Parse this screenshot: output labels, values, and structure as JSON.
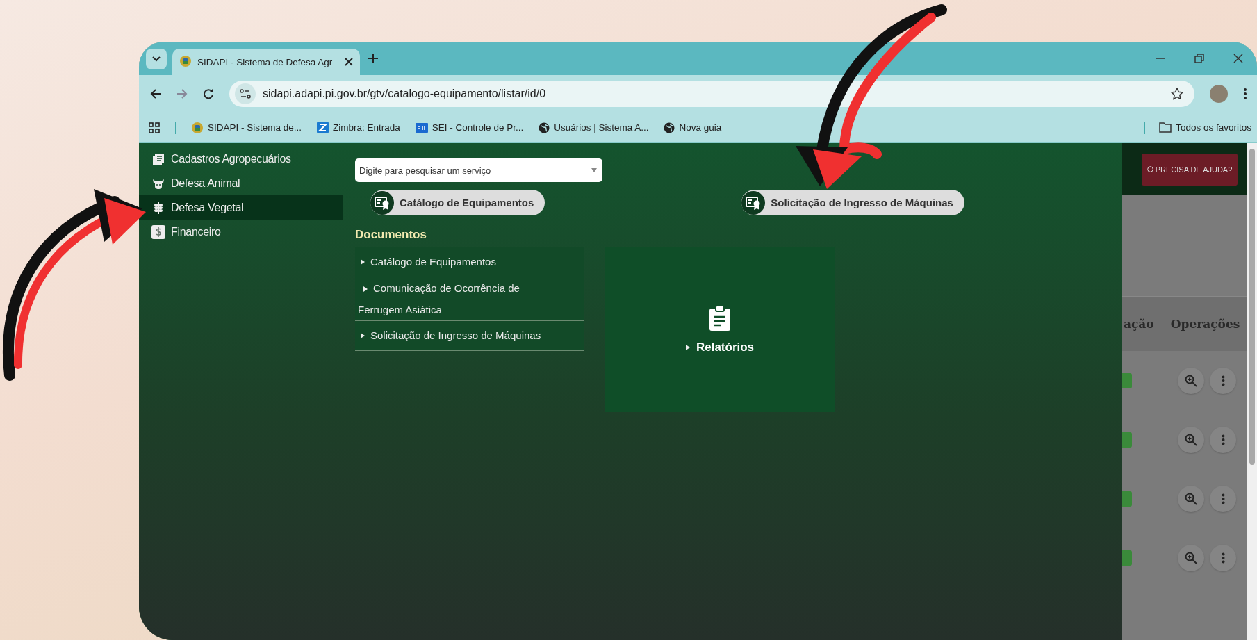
{
  "browser": {
    "tab_title": "SIDAPI - Sistema de Defesa Agr",
    "url": "sidapi.adapi.pi.gov.br/gtv/catalogo-equipamento/listar/id/0",
    "bookmarks": [
      {
        "kind": "logo",
        "label": "SIDAPI - Sistema de..."
      },
      {
        "kind": "zimbra",
        "label": "Zimbra: Entrada"
      },
      {
        "kind": "sei",
        "label": "SEI - Controle de Pr..."
      },
      {
        "kind": "globe",
        "label": "Usuários | Sistema A..."
      },
      {
        "kind": "globe",
        "label": "Nova guia"
      }
    ],
    "all_bookmarks": "Todos os favoritos"
  },
  "sidebar": {
    "items": [
      {
        "kind": "records",
        "label": "Cadastros Agropecuários",
        "selected": false
      },
      {
        "kind": "animal",
        "label": "Defesa Animal",
        "selected": false
      },
      {
        "kind": "plant",
        "label": "Defesa Vegetal",
        "selected": true
      },
      {
        "kind": "finance",
        "label": "Financeiro",
        "selected": false
      }
    ]
  },
  "search": {
    "placeholder": "Digite para pesquisar um serviço"
  },
  "quick_links": [
    {
      "label": "Catálogo de Equipamentos"
    },
    {
      "label": "Solicitação de Ingresso de Máquinas"
    }
  ],
  "documents": {
    "title": "Documentos",
    "items": [
      "Catálogo de Equipamentos",
      "Comunicação de Ocorrência de Ferrugem Asiática",
      "Solicitação de Ingresso de Máquinas"
    ]
  },
  "reports_tile": {
    "label": "Relatórios"
  },
  "background_page": {
    "help_button": "PRECISA DE AJUDA?",
    "columns": [
      "ação",
      "Operações"
    ]
  }
}
